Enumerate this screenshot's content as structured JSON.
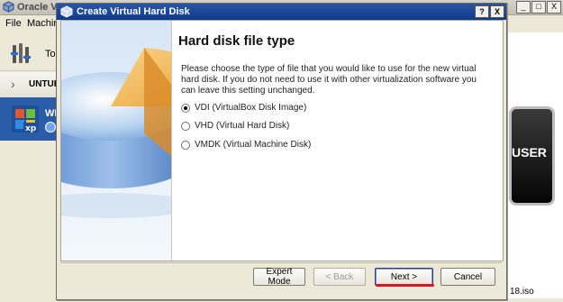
{
  "background_window": {
    "title": "Oracle VM VirtualBox Manager",
    "menu": [
      "File",
      "Machine"
    ],
    "toolbar_label": "Tools",
    "group_label": "UNTUK",
    "vm_name": "WINDOWS XP",
    "preview_text": "USER",
    "iso_text": "18.iso",
    "window_buttons": [
      "_",
      "□",
      "X"
    ]
  },
  "dialog": {
    "title": "Create Virtual Hard Disk",
    "title_buttons": [
      "?",
      "X"
    ],
    "page_title": "Hard disk file type",
    "description": "Please choose the type of file that you would like to use for the new virtual hard disk. If you do not need to use it with other virtualization software you can leave this setting unchanged.",
    "options": [
      {
        "label": "VDI (VirtualBox Disk Image)",
        "checked": true
      },
      {
        "label": "VHD (Virtual Hard Disk)",
        "checked": false
      },
      {
        "label": "VMDK (Virtual Machine Disk)",
        "checked": false
      }
    ],
    "buttons": {
      "expert": "Expert Mode",
      "back": "< Back",
      "next": "Next >",
      "cancel": "Cancel"
    },
    "highlight_color": "#e0121e"
  }
}
